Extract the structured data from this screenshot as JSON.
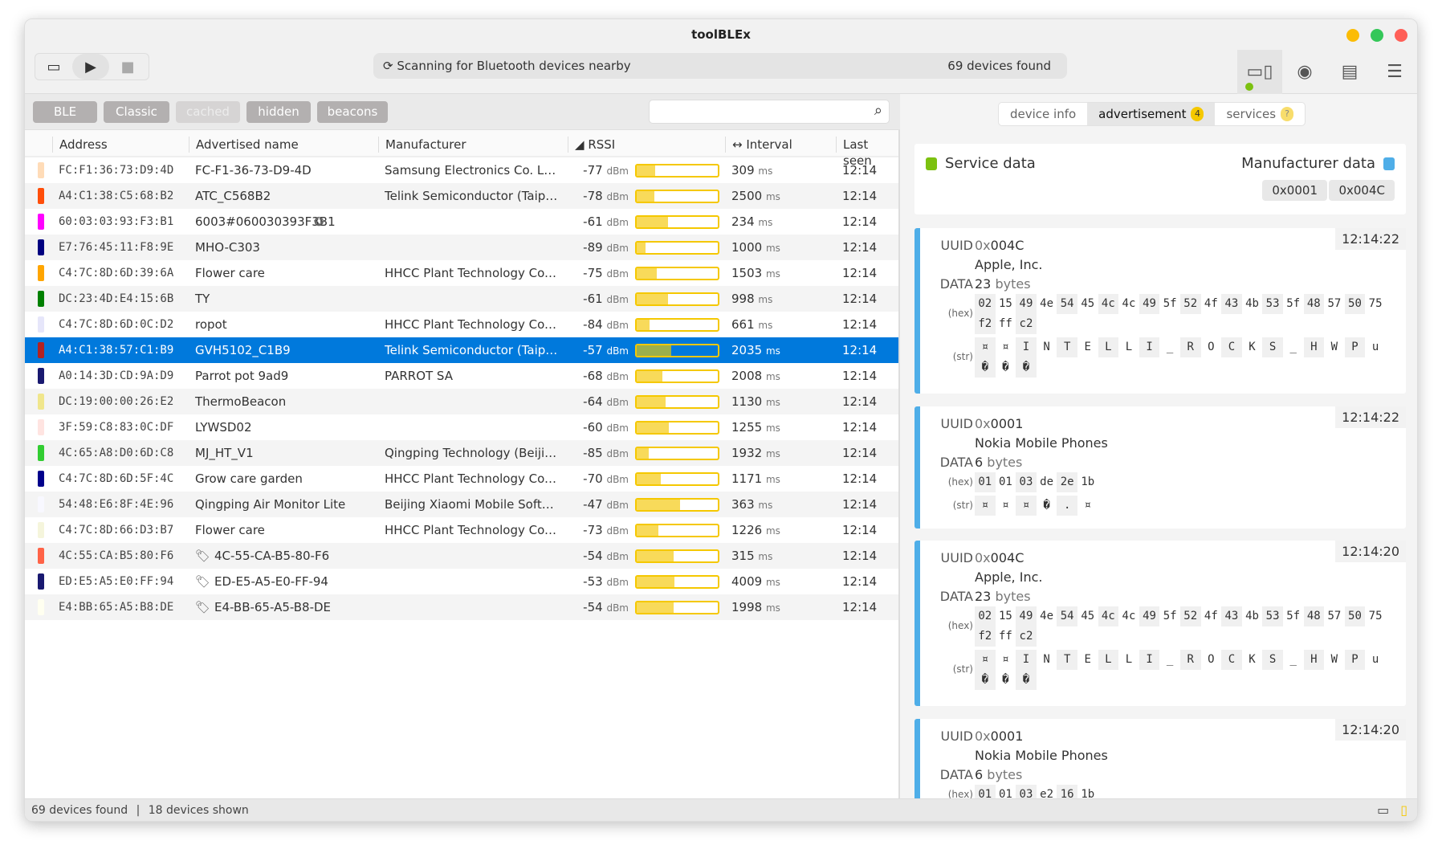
{
  "window": {
    "title": "toolBLEx"
  },
  "toolbar": {
    "scan_status": "Scanning for Bluetooth devices nearby",
    "devices_found": "69 devices found"
  },
  "filters": [
    "BLE",
    "Classic",
    "cached",
    "hidden",
    "beacons"
  ],
  "search": {
    "placeholder": "",
    "value": ""
  },
  "table": {
    "headers": {
      "address": "Address",
      "name": "Advertised name",
      "manufacturer": "Manufacturer",
      "rssi": "RSSI",
      "interval": "Interval",
      "last_seen": "Last seen"
    },
    "rssi_unit": "dBm",
    "interval_unit": "ms",
    "rows": [
      {
        "color": "#ffdcb8",
        "address": "FC:F1:36:73:D9:4D",
        "name": "FC-F1-36-73-D9-4D",
        "manufacturer": "Samsung Electronics Co. Ltd.",
        "rssi": "-77",
        "interval": "309",
        "last_seen": "12:14"
      },
      {
        "color": "#ff4e0a",
        "address": "A4:C1:38:C5:68:B2",
        "name": "ATC_C568B2",
        "manufacturer": "Telink Semiconductor (Taipei) Co. Ltd.",
        "rssi": "-78",
        "interval": "2500",
        "last_seen": "12:14"
      },
      {
        "color": "#ff00ff",
        "address": "60:03:03:93:F3:B1",
        "name": "6003#060030393F3B1",
        "manufacturer": "",
        "rssi": "-61",
        "interval": "234",
        "last_seen": "12:14",
        "icon": "star-badge"
      },
      {
        "color": "#000080",
        "address": "E7:76:45:11:F8:9E",
        "name": "MHO-C303",
        "manufacturer": "",
        "rssi": "-89",
        "interval": "1000",
        "last_seen": "12:14"
      },
      {
        "color": "#ffa500",
        "address": "C4:7C:8D:6D:39:6A",
        "name": "Flower care",
        "manufacturer": "HHCC Plant Technology Co. Ltd.",
        "rssi": "-75",
        "interval": "1503",
        "last_seen": "12:14"
      },
      {
        "color": "#008000",
        "address": "DC:23:4D:E4:15:6B",
        "name": "TY",
        "manufacturer": "",
        "rssi": "-61",
        "interval": "998",
        "last_seen": "12:14"
      },
      {
        "color": "#e6e6fa",
        "address": "C4:7C:8D:6D:0C:D2",
        "name": "ropot",
        "manufacturer": "HHCC Plant Technology Co. Ltd.",
        "rssi": "-84",
        "interval": "661",
        "last_seen": "12:14"
      },
      {
        "color": "#b22222",
        "address": "A4:C1:38:57:C1:B9",
        "name": "GVH5102_C1B9",
        "manufacturer": "Telink Semiconductor (Taipei) Co. Ltd.",
        "rssi": "-57",
        "interval": "2035",
        "last_seen": "12:14",
        "selected": true
      },
      {
        "color": "#191970",
        "address": "A0:14:3D:CD:9A:D9",
        "name": "Parrot pot 9ad9",
        "manufacturer": "PARROT SA",
        "rssi": "-68",
        "interval": "2008",
        "last_seen": "12:14"
      },
      {
        "color": "#f0e68c",
        "address": "DC:19:00:00:26:E2",
        "name": "ThermoBeacon",
        "manufacturer": "",
        "rssi": "-64",
        "interval": "1130",
        "last_seen": "12:14"
      },
      {
        "color": "#ffe4e1",
        "address": "3F:59:C8:83:0C:DF",
        "name": "LYWSD02",
        "manufacturer": "",
        "rssi": "-60",
        "interval": "1255",
        "last_seen": "12:14"
      },
      {
        "color": "#32cd32",
        "address": "4C:65:A8:D0:6D:C8",
        "name": "MJ_HT_V1",
        "manufacturer": "Qingping Technology (Beijing) Co. Ltd.",
        "rssi": "-85",
        "interval": "1932",
        "last_seen": "12:14"
      },
      {
        "color": "#00008b",
        "address": "C4:7C:8D:6D:5F:4C",
        "name": "Grow care garden",
        "manufacturer": "HHCC Plant Technology Co. Ltd.",
        "rssi": "-70",
        "interval": "1171",
        "last_seen": "12:14"
      },
      {
        "color": "#f8f8ff",
        "address": "54:48:E6:8F:4E:96",
        "name": "Qingping Air Monitor Lite",
        "manufacturer": "Beijing Xiaomi Mobile Software Co. Ltd.",
        "rssi": "-47",
        "interval": "363",
        "last_seen": "12:14"
      },
      {
        "color": "#f5f5dc",
        "address": "C4:7C:8D:66:D3:B7",
        "name": "Flower care",
        "manufacturer": "HHCC Plant Technology Co. Ltd.",
        "rssi": "-73",
        "interval": "1226",
        "last_seen": "12:14"
      },
      {
        "color": "#ff6347",
        "address": "4C:55:CA:B5:80:F6",
        "name": "4C-55-CA-B5-80-F6",
        "manufacturer": "",
        "rssi": "-54",
        "interval": "315",
        "last_seen": "12:14",
        "icon": "tag"
      },
      {
        "color": "#191970",
        "address": "ED:E5:A5:E0:FF:94",
        "name": "ED-E5-A5-E0-FF-94",
        "manufacturer": "",
        "rssi": "-53",
        "interval": "4009",
        "last_seen": "12:14",
        "icon": "tag"
      },
      {
        "color": "#fffff0",
        "address": "E4:BB:65:A5:B8:DE",
        "name": "E4-BB-65-A5-B8-DE",
        "manufacturer": "",
        "rssi": "-54",
        "interval": "1998",
        "last_seen": "12:14",
        "icon": "tag"
      }
    ]
  },
  "status": {
    "found": "69 devices found",
    "shown": "18 devices shown",
    "separator": "|"
  },
  "detail": {
    "tabs": [
      {
        "label": "device info"
      },
      {
        "label": "advertisement",
        "badge": "4",
        "active": true
      },
      {
        "label": "services",
        "badge": "?"
      }
    ],
    "legend": {
      "service": "Service data",
      "manufacturer": "Manufacturer data",
      "service_color": "#7cc110",
      "manufacturer_color": "#4faee8"
    },
    "manufacturer_ids": [
      "0x0001",
      "0x004C"
    ],
    "labels": {
      "uuid": "UUID",
      "data": "DATA",
      "hex": "(hex)",
      "str": "(str)",
      "prefix": "0x",
      "bytes": "bytes"
    },
    "entries": [
      {
        "time": "12:14:22",
        "uuid": "004C",
        "company": "Apple, Inc.",
        "size": "23",
        "hex": [
          "02",
          "15",
          "49",
          "4e",
          "54",
          "45",
          "4c",
          "4c",
          "49",
          "5f",
          "52",
          "4f",
          "43",
          "4b",
          "53",
          "5f",
          "48",
          "57",
          "50",
          "75",
          "f2",
          "ff",
          "c2"
        ],
        "str": [
          "¤",
          "¤",
          "I",
          "N",
          "T",
          "E",
          "L",
          "L",
          "I",
          "_",
          "R",
          "O",
          "C",
          "K",
          "S",
          "_",
          "H",
          "W",
          "P",
          "u",
          "�",
          "�",
          "�"
        ]
      },
      {
        "time": "12:14:22",
        "uuid": "0001",
        "company": "Nokia Mobile Phones",
        "size": "6",
        "hex": [
          "01",
          "01",
          "03",
          "de",
          "2e",
          "1b"
        ],
        "str": [
          "¤",
          "¤",
          "¤",
          "�",
          ".",
          "¤"
        ]
      },
      {
        "time": "12:14:20",
        "uuid": "004C",
        "company": "Apple, Inc.",
        "size": "23",
        "hex": [
          "02",
          "15",
          "49",
          "4e",
          "54",
          "45",
          "4c",
          "4c",
          "49",
          "5f",
          "52",
          "4f",
          "43",
          "4b",
          "53",
          "5f",
          "48",
          "57",
          "50",
          "75",
          "f2",
          "ff",
          "c2"
        ],
        "str": [
          "¤",
          "¤",
          "I",
          "N",
          "T",
          "E",
          "L",
          "L",
          "I",
          "_",
          "R",
          "O",
          "C",
          "K",
          "S",
          "_",
          "H",
          "W",
          "P",
          "u",
          "�",
          "�",
          "�"
        ]
      },
      {
        "time": "12:14:20",
        "uuid": "0001",
        "company": "Nokia Mobile Phones",
        "size": "6",
        "hex": [
          "01",
          "01",
          "03",
          "e2",
          "16",
          "1b"
        ]
      }
    ]
  }
}
